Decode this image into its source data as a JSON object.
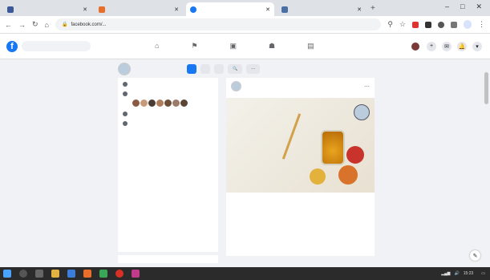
{
  "browser": {
    "tabs": [
      {
        "label": "",
        "icon_color": "#3b5998",
        "active": false
      },
      {
        "label": "",
        "icon_color": "#e86e2a",
        "active": false
      },
      {
        "label": "",
        "icon_color": "#1877f2",
        "active": true
      },
      {
        "label": "",
        "icon_color": "#4a6fa5",
        "active": false
      }
    ],
    "new_tab_label": "+",
    "window_controls": [
      "–",
      "□",
      "✕"
    ],
    "url": "facebook.com/...",
    "profile_label": ""
  },
  "facebook": {
    "logo": "f",
    "search_placeholder": "",
    "nav_icons": [
      "home-icon",
      "flag-icon",
      "marketplace-icon",
      "groups-icon",
      "gaming-icon"
    ],
    "user_name": ""
  },
  "page": {
    "name": "",
    "buttons": {
      "primary": "",
      "like": "",
      "message": "",
      "search": "🔍",
      "more": "⋯"
    }
  },
  "sidebar": {
    "items": [
      {
        "icon": "info-icon",
        "text": "",
        "link": ""
      },
      {
        "icon": "like-icon",
        "text": ""
      },
      {
        "icon": "phone-icon",
        "text": ""
      },
      {
        "icon": "globe-icon",
        "text": "",
        "link": ""
      }
    ],
    "recommend_title": ""
  },
  "post": {
    "page_name": "",
    "date": "",
    "greeting": "",
    "body": "",
    "link_text": "",
    "image_caption": "",
    "reactions_text": "",
    "comments_text": "",
    "actions": [
      "",
      "",
      ""
    ]
  },
  "taskbar": {
    "time": "15:23",
    "date": ""
  }
}
